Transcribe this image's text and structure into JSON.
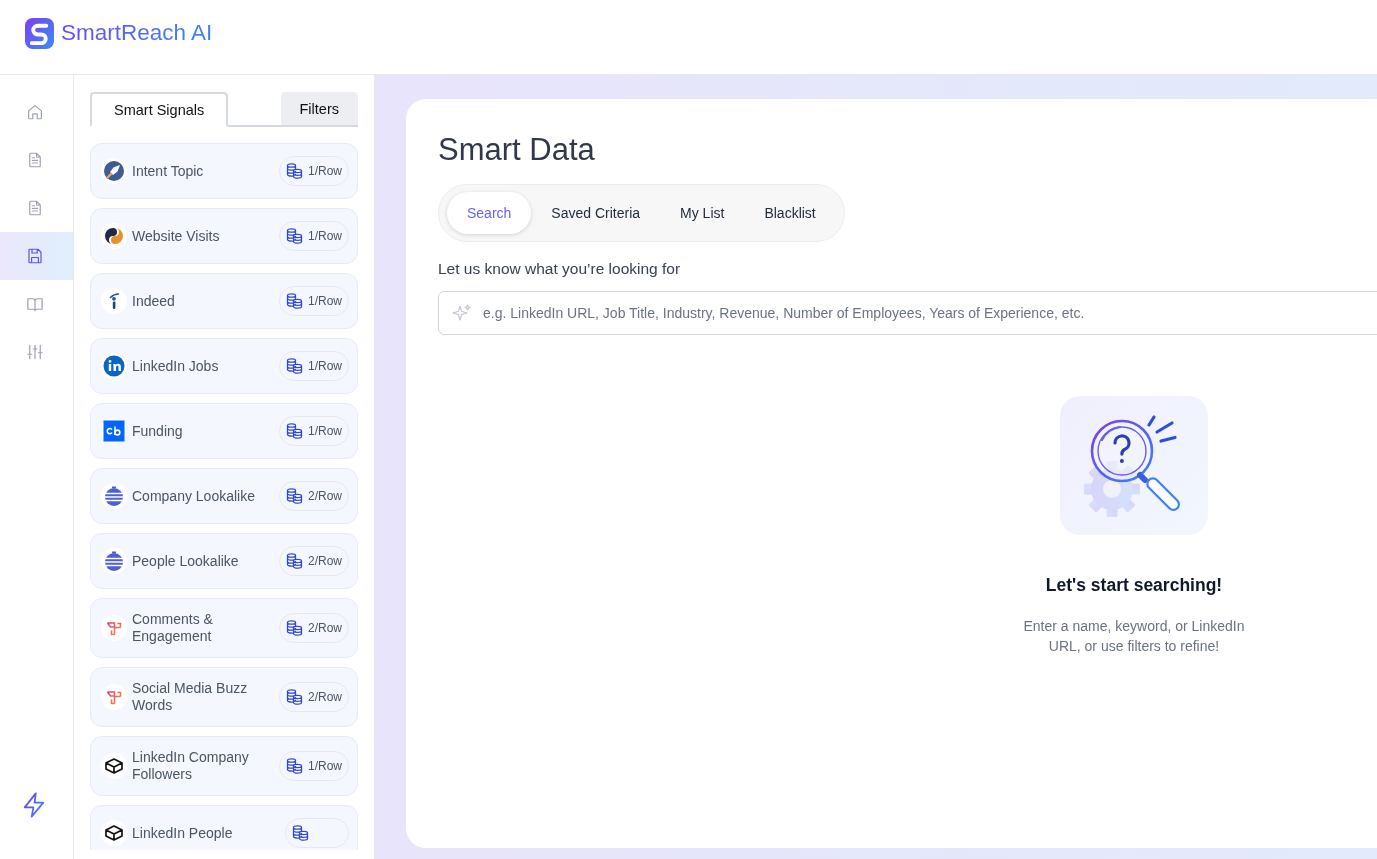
{
  "header": {
    "brand": "SmartReach AI"
  },
  "nav": {
    "items": [
      {
        "kind": "home",
        "selected": false
      },
      {
        "kind": "document",
        "selected": false
      },
      {
        "kind": "document",
        "selected": false
      },
      {
        "kind": "save",
        "selected": true
      },
      {
        "kind": "book",
        "selected": false
      },
      {
        "kind": "sliders",
        "selected": false
      }
    ],
    "footer_item": {
      "kind": "bolt"
    }
  },
  "signals_panel": {
    "tabs": [
      {
        "label": "Smart Signals",
        "selected": true
      },
      {
        "label": "Filters",
        "selected": false
      }
    ],
    "items": [
      {
        "kind": "rocket",
        "label": "Intent Topic",
        "cost": "1/Row"
      },
      {
        "kind": "swirl",
        "label": "Website Visits",
        "cost": "1/Row"
      },
      {
        "kind": "marker",
        "label": "Indeed",
        "cost": "1/Row"
      },
      {
        "kind": "linkedin",
        "label": "LinkedIn Jobs",
        "cost": "1/Row"
      },
      {
        "kind": "square",
        "label": "Funding",
        "cost": "1/Row"
      },
      {
        "kind": "stripes",
        "label": "Company Lookalike",
        "cost": "2/Row"
      },
      {
        "kind": "stripes",
        "label": "People Lookalike",
        "cost": "2/Row"
      },
      {
        "kind": "knot",
        "label": "Comments & Engagement",
        "cost": "2/Row"
      },
      {
        "kind": "knot",
        "label": "Social Media Buzz Words",
        "cost": "2/Row"
      },
      {
        "kind": "cube",
        "label": "LinkedIn Company Followers",
        "cost": "1/Row"
      },
      {
        "kind": "cube",
        "label": "LinkedIn People"
      }
    ]
  },
  "main": {
    "title": "Smart Data",
    "tabs": [
      {
        "label": "Search",
        "selected": true
      },
      {
        "label": "Saved Criteria",
        "selected": false
      },
      {
        "label": "My List",
        "selected": false
      },
      {
        "label": "Blacklist",
        "selected": false
      }
    ],
    "prompt": "Let us know what you’re looking for",
    "search": {
      "placeholder": "e.g. LinkedIn URL, Job Title, Industry, Revenue, Number of Employees, Years of Experience, etc."
    },
    "empty_state": {
      "title": "Let's start searching!",
      "text": "Enter a name, keyword, or LinkedIn URL, or use filters to refine!"
    }
  }
}
